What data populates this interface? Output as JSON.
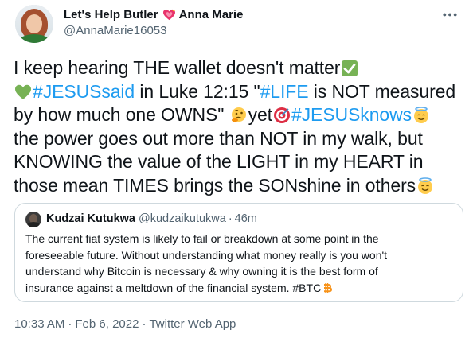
{
  "author": {
    "display_name": "Let's Help Butler",
    "display_name_suffix": "Anna Marie",
    "handle": "@AnnaMarie16053"
  },
  "tweet": {
    "l1": "I keep hearing THE wallet doesn't matter",
    "l2_tag": "#JESUSsaid",
    "l2_a": " in Luke 12:15 \"",
    "l2_tag2": "#LIFE",
    "l2_b": " is NOT measured",
    "l3_a": "by how much one OWNS\" ",
    "l3_b": "yet",
    "l3_tag": "#JESUSknows",
    "l4": "the power goes out more than NOT in my walk, but",
    "l5": "KNOWING the value of the LIGHT in my HEART in",
    "l6": "those mean TIMES brings the SONshine in others"
  },
  "quote": {
    "display_name": "Kudzai Kutukwa",
    "handle": "@kudzaikutukwa",
    "separator": "·",
    "time": "46m",
    "l1": "The current fiat system is likely to fail or breakdown at some point in the",
    "l2": "foreseeable future. Without understanding what money really is you won't",
    "l3": "understand why Bitcoin is necessary & why owning it is the best form of",
    "l4": "insurance against a meltdown of the financial system. #BTC"
  },
  "meta": {
    "time": "10:33 AM",
    "separator": "·",
    "date": "Feb 6, 2022",
    "source": "Twitter Web App"
  },
  "icons": {
    "heart": "sparkling-heart-icon",
    "check": "check-mark-icon",
    "green_heart": "green-heart-icon",
    "thinking": "thinking-face-icon",
    "target": "direct-hit-icon",
    "halo": "smiling-face-with-halo-icon",
    "bitcoin": "bitcoin-icon",
    "more": "more-icon"
  },
  "colors": {
    "accent": "#1d9bf0",
    "text": "#0f1419",
    "muted": "#536471",
    "border": "#cfd9de"
  }
}
